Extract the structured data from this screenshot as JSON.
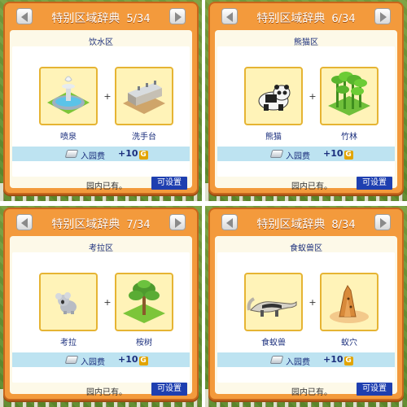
{
  "screen": {
    "panels": [
      {
        "title": "特别区域辞典",
        "page": "5/34",
        "zone": "饮水区",
        "item_a": {
          "label": "喷泉",
          "icon": "fountain-icon"
        },
        "item_b": {
          "label": "洗手台",
          "icon": "washstand-icon"
        },
        "plus": "+",
        "fee_label": "入园费",
        "fee_value": "+10",
        "fee_currency": "G",
        "owned_text": "园内已有。",
        "button_label": "可设置"
      },
      {
        "title": "特别区域辞典",
        "page": "6/34",
        "zone": "熊猫区",
        "item_a": {
          "label": "熊猫",
          "icon": "panda-icon"
        },
        "item_b": {
          "label": "竹林",
          "icon": "bamboo-icon"
        },
        "plus": "+",
        "fee_label": "入园费",
        "fee_value": "+10",
        "fee_currency": "G",
        "owned_text": "园内已有。",
        "button_label": "可设置"
      },
      {
        "title": "特别区域辞典",
        "page": "7/34",
        "zone": "考拉区",
        "item_a": {
          "label": "考拉",
          "icon": "koala-icon"
        },
        "item_b": {
          "label": "桉树",
          "icon": "eucalyptus-icon"
        },
        "plus": "+",
        "fee_label": "入园费",
        "fee_value": "+10",
        "fee_currency": "G",
        "owned_text": "园内已有。",
        "button_label": "可设置"
      },
      {
        "title": "特别区域辞典",
        "page": "8/34",
        "zone": "食蚁兽区",
        "item_a": {
          "label": "食蚁兽",
          "icon": "anteater-icon"
        },
        "item_b": {
          "label": "蚁穴",
          "icon": "anthill-icon"
        },
        "plus": "+",
        "fee_label": "入园费",
        "fee_value": "+10",
        "fee_currency": "G",
        "owned_text": "园内已有。",
        "button_label": "可设置"
      }
    ],
    "colors": {
      "dialog": "#f39a3c",
      "content_bg": "#fdf9e8",
      "fee_bar": "#bde3f1",
      "button": "#1e3fb0",
      "text_blue": "#1b2f7d",
      "item_border": "#e6b433"
    }
  }
}
